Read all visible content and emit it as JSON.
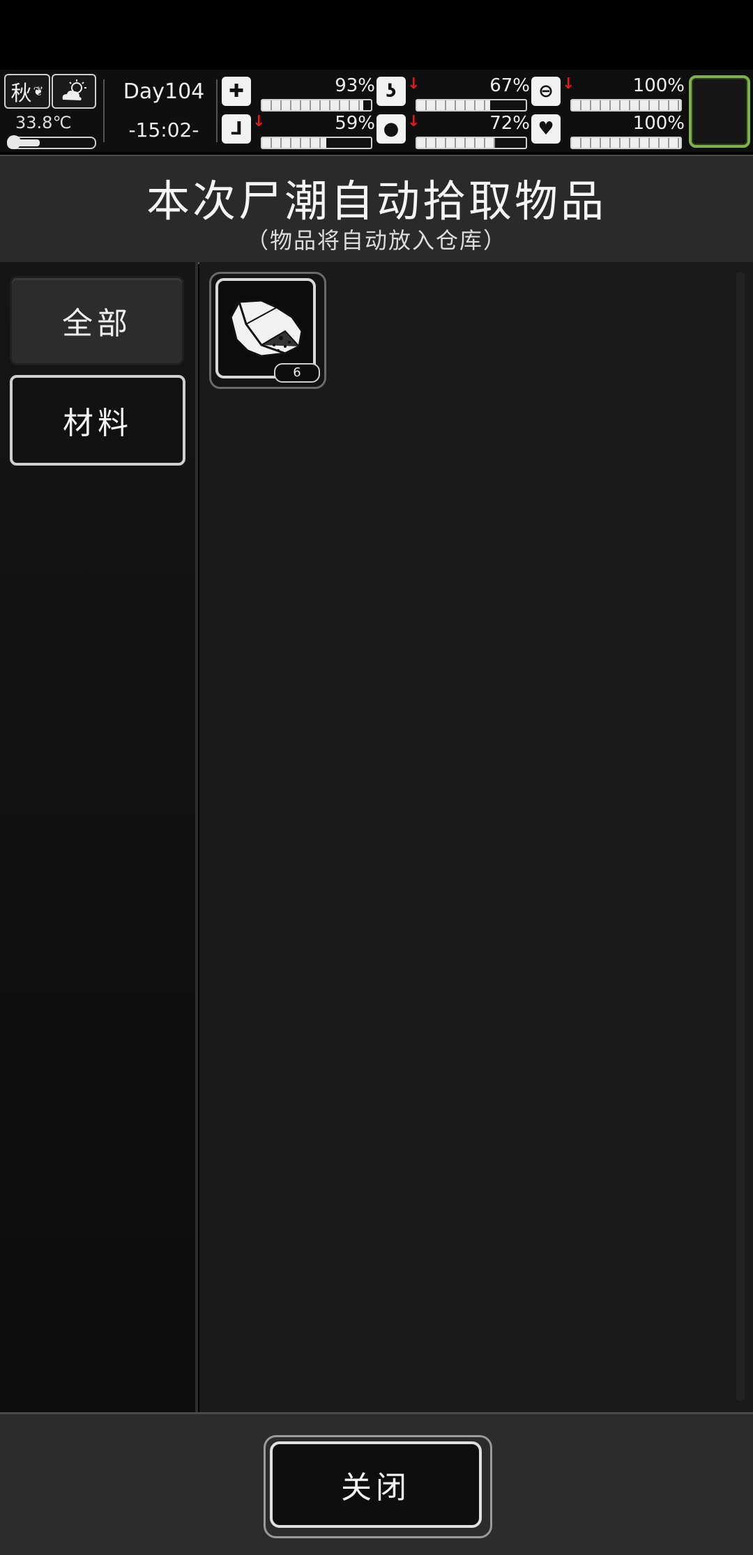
{
  "hud": {
    "season": "秋",
    "temperature": "33.8℃",
    "temperature_level": 0.35,
    "day": "Day104",
    "time": "-15:02-",
    "stats": [
      {
        "id": "health",
        "icon": "medkit-icon",
        "value": "93%",
        "level": 0.93,
        "decreasing": false
      },
      {
        "id": "hunger",
        "icon": "stomach-icon",
        "value": "67%",
        "level": 0.67,
        "decreasing": true
      },
      {
        "id": "energy",
        "icon": "pill-icon",
        "value": "100%",
        "level": 1.0,
        "decreasing": true
      },
      {
        "id": "stamina",
        "icon": "boot-icon",
        "value": "59%",
        "level": 0.59,
        "decreasing": true
      },
      {
        "id": "thirst",
        "icon": "water-drop-icon",
        "value": "72%",
        "level": 0.72,
        "decreasing": true
      },
      {
        "id": "mood",
        "icon": "heart-icon",
        "value": "100%",
        "level": 1.0,
        "decreasing": false
      }
    ]
  },
  "dialog": {
    "title": "本次尸潮自动拾取物品",
    "subtitle": "（物品将自动放入仓库）",
    "tabs": [
      {
        "label": "全部",
        "selected": false
      },
      {
        "label": "材料",
        "selected": true
      }
    ],
    "items": [
      {
        "icon": "rock-ore-icon",
        "count": "6"
      }
    ],
    "close_label": "关闭"
  },
  "colors": {
    "accent_green": "#7fb24a",
    "alert_red": "#d42020"
  }
}
